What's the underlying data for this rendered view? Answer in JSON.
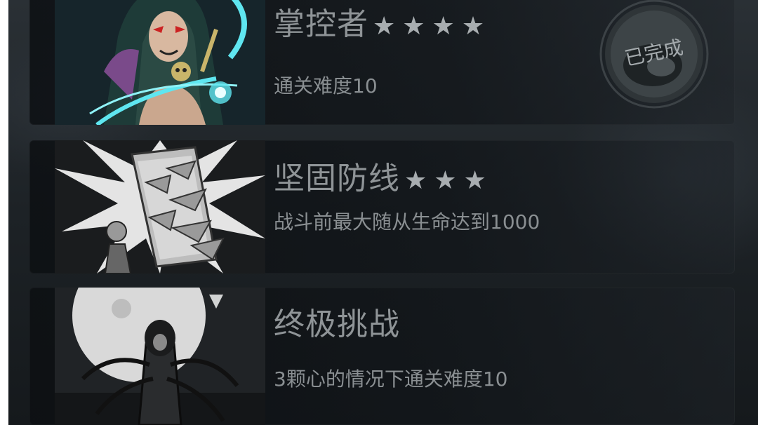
{
  "achievements": [
    {
      "title": "掌控者",
      "stars": "★★★★",
      "description": "通关难度10",
      "status": "已完成"
    },
    {
      "title": "坚固防线",
      "stars": "★★★",
      "description": "战斗前最大随从生命达到1000"
    },
    {
      "title": "终极挑战",
      "stars": "",
      "description": "3颗心的情况下通关难度10"
    }
  ],
  "colors": {
    "text": "#8f9497",
    "background": "#1d2226",
    "accent_cyan": "#5fe6f0"
  }
}
